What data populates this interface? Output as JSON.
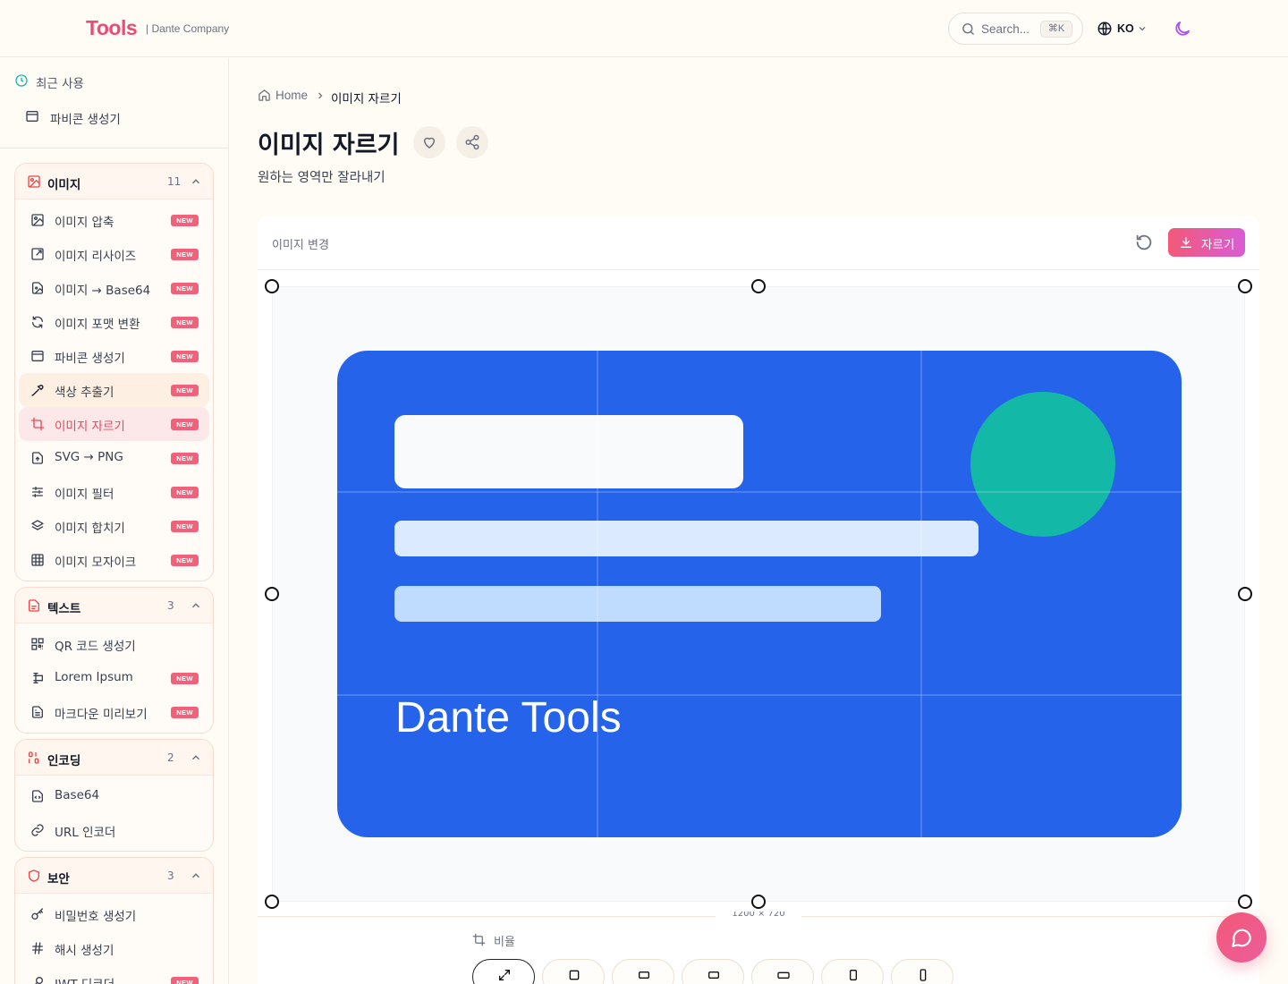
{
  "header": {
    "logo": "Tools",
    "logo_sub": "| Dante Company",
    "search_placeholder": "Search...",
    "search_kbd": "⌘K",
    "lang": "KO"
  },
  "sidebar": {
    "recent_title": "최근 사용",
    "recent_items": [
      {
        "label": "파비콘 생성기",
        "icon": "browser-icon"
      }
    ],
    "categories": [
      {
        "name": "이미지",
        "count": "11",
        "icon": "image-icon",
        "items": [
          {
            "label": "이미지 압축",
            "badge": "NEW",
            "icon": "image-compress-icon"
          },
          {
            "label": "이미지 리사이즈",
            "badge": "NEW",
            "icon": "resize-icon"
          },
          {
            "label": "이미지 → Base64",
            "badge": "NEW",
            "icon": "file-image-icon"
          },
          {
            "label": "이미지 포맷 변환",
            "badge": "NEW",
            "icon": "refresh-icon"
          },
          {
            "label": "파비콘 생성기",
            "badge": "NEW",
            "icon": "browser-icon"
          },
          {
            "label": "색상 추출기",
            "badge": "NEW",
            "icon": "pipette-icon",
            "state": "hover"
          },
          {
            "label": "이미지 자르기",
            "badge": "NEW",
            "icon": "crop-icon",
            "state": "active"
          },
          {
            "label": "SVG → PNG",
            "badge": "NEW",
            "icon": "file-code-icon"
          },
          {
            "label": "이미지 필터",
            "badge": "NEW",
            "icon": "sliders-icon"
          },
          {
            "label": "이미지 합치기",
            "badge": "NEW",
            "icon": "layers-icon"
          },
          {
            "label": "이미지 모자이크",
            "badge": "NEW",
            "icon": "grid-icon"
          }
        ]
      },
      {
        "name": "텍스트",
        "count": "3",
        "icon": "file-text-icon",
        "items": [
          {
            "label": "QR 코드 생성기",
            "badge": "",
            "icon": "qr-icon"
          },
          {
            "label": "Lorem Ipsum",
            "badge": "NEW",
            "icon": "text-cursor-icon"
          },
          {
            "label": "마크다운 미리보기",
            "badge": "NEW",
            "icon": "file-doc-icon"
          }
        ]
      },
      {
        "name": "인코딩",
        "count": "2",
        "icon": "binary-icon",
        "items": [
          {
            "label": "Base64",
            "badge": "",
            "icon": "file-code-icon"
          },
          {
            "label": "URL 인코더",
            "badge": "",
            "icon": "link-icon"
          }
        ]
      },
      {
        "name": "보안",
        "count": "3",
        "icon": "shield-icon",
        "items": [
          {
            "label": "비밀번호 생성기",
            "badge": "",
            "icon": "key-icon"
          },
          {
            "label": "해시 생성기",
            "badge": "",
            "icon": "hash-icon"
          },
          {
            "label": "JWT 디코더",
            "badge": "NEW",
            "icon": "key-round-icon"
          }
        ]
      }
    ]
  },
  "main": {
    "breadcrumb_home": "Home",
    "breadcrumb_current": "이미지 자르기",
    "title": "이미지 자르기",
    "subtitle": "원하는 영역만 잘라내기",
    "change_image": "이미지 변경",
    "crop_button": "자르기",
    "ratio_label": "비율",
    "size_readout": "1200 × 720",
    "ratio_icons": [
      "expand-icon",
      "square-icon",
      "landscape-icon",
      "landscape-wide-icon",
      "widescreen-icon",
      "portrait-icon",
      "tall-portrait-icon"
    ],
    "preview_text": "Dante Tools"
  },
  "colors": {
    "brand": "#e94b7a",
    "accent_gradient_start": "#f25a77",
    "accent_gradient_end": "#d95cd6",
    "preview_blue": "#2563eb",
    "preview_green": "#14b8a6"
  }
}
